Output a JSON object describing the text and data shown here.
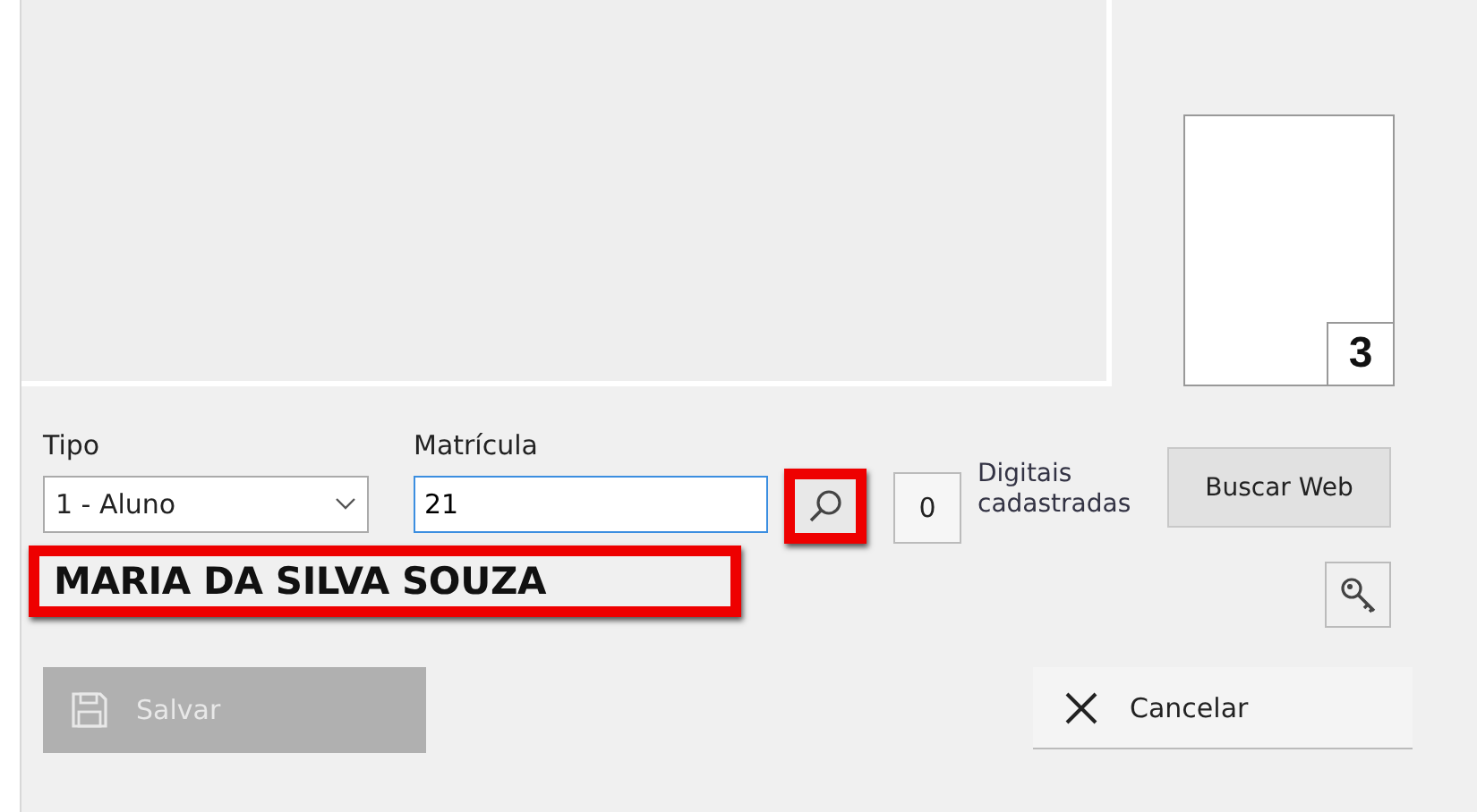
{
  "photo": {
    "number": "3"
  },
  "tipo": {
    "label": "Tipo",
    "value": "1 - Aluno"
  },
  "matricula": {
    "label": "Matrícula",
    "value": "21"
  },
  "search_button": {
    "highlighted": true
  },
  "fingerprints": {
    "count": "0",
    "label": "Digitais cadastradas"
  },
  "buscar_web": {
    "label": "Buscar Web"
  },
  "name": {
    "text": "MARIA DA SILVA SOUZA",
    "highlighted": true
  },
  "buttons": [
    {
      "kind": "save",
      "label": "Salvar",
      "disabled": true
    },
    {
      "kind": "cancel",
      "label": "Cancelar",
      "disabled": false
    }
  ]
}
